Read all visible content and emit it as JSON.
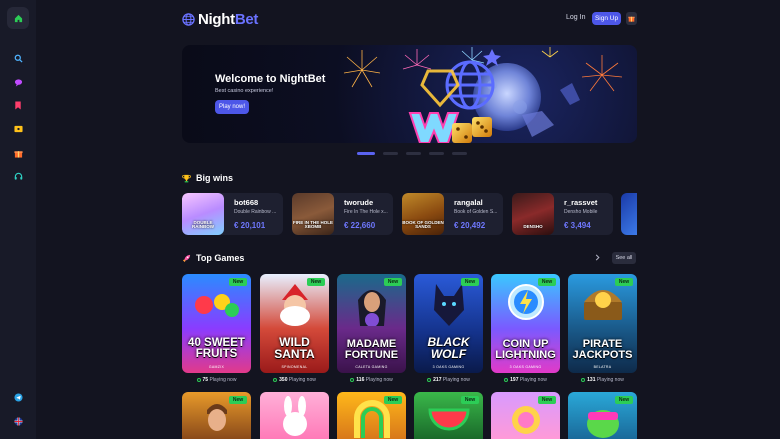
{
  "header": {
    "logo_night": "Night",
    "logo_bet": "Bet",
    "login_label": "Log In",
    "signup_label": "Sign Up"
  },
  "sidebar": {
    "icons": [
      "home-icon",
      "search-icon",
      "chat-icon",
      "bookmark-icon",
      "ticket-icon",
      "gift-icon",
      "support-icon",
      "telegram-icon",
      "language-flag-icon"
    ]
  },
  "banner": {
    "title": "Welcome to NightBet",
    "subtitle": "Best casino experience!",
    "cta_label": "Play now!",
    "slides": 5,
    "active_slide": 1
  },
  "big_wins": {
    "title": "Big wins",
    "items": [
      {
        "user": "bot668",
        "game": "Double Rainbow ...",
        "amount": "€ 20,101",
        "thumb_text": "DOUBLE RAINBOW"
      },
      {
        "user": "tworude",
        "game": "Fire In The Hole x...",
        "amount": "€ 22,660",
        "thumb_text": "FIRE IN THE HOLE XBOMB"
      },
      {
        "user": "rangalal",
        "game": "Book of Golden S...",
        "amount": "€ 20,492",
        "thumb_text": "BOOK OF GOLDEN SANDS"
      },
      {
        "user": "r_rassvet",
        "game": "Densho Mobile",
        "amount": "€ 3,494",
        "thumb_text": "DENSHO"
      }
    ]
  },
  "top_games": {
    "title": "Top Games",
    "see_all_label": "See all",
    "new_label": "New",
    "playing_suffix": "Playing now",
    "items": [
      {
        "title": "40 SWEET FRUITS",
        "provider": "GAMZIX",
        "playing": "75"
      },
      {
        "title": "WILD SANTA",
        "provider": "SPINOMENAL",
        "playing": "350"
      },
      {
        "title": "MADAME FORTUNE",
        "provider": "CALETA GAMING",
        "playing": "116"
      },
      {
        "title": "BLACK WOLF",
        "provider": "3 OAKS GAMING",
        "playing": "217"
      },
      {
        "title": "COIN UP LIGHTNING",
        "provider": "3 OAKS GAMING",
        "playing": "197"
      },
      {
        "title": "PIRATE JACKPOTS",
        "provider": "BELATRA",
        "playing": "131"
      }
    ]
  },
  "colors": {
    "accent": "#4d57e8",
    "brand_blue": "#6a72ff",
    "new_badge": "#2ccd56",
    "background": "#131420"
  }
}
